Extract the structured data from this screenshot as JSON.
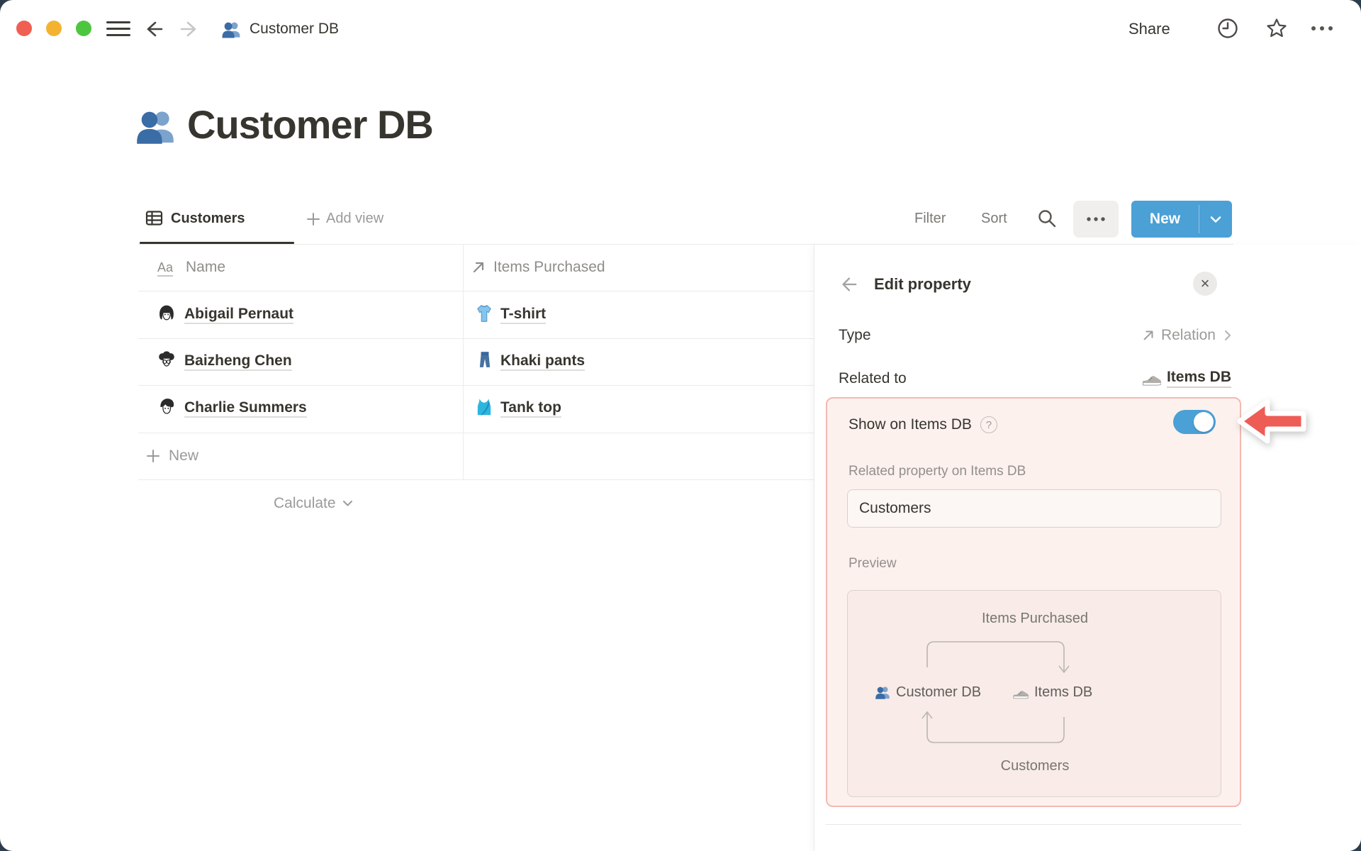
{
  "topbar": {
    "document_title": "Customer DB",
    "share_label": "Share"
  },
  "page": {
    "icon": "people-icon",
    "title": "Customer DB"
  },
  "view_bar": {
    "active_view": "Customers",
    "add_view_label": "Add view",
    "filter_label": "Filter",
    "sort_label": "Sort",
    "new_button_label": "New"
  },
  "table": {
    "columns": [
      {
        "icon": "title-aa-icon",
        "label": "Name"
      },
      {
        "icon": "relation-arrow-icon",
        "label": "Items Purchased"
      }
    ],
    "rows": [
      {
        "avatar": "avatar-abigail",
        "name": "Abigail Pernaut",
        "item_icon": "t-shirt-icon",
        "item": "T-shirt"
      },
      {
        "avatar": "avatar-baizheng",
        "name": "Baizheng Chen",
        "item_icon": "jeans-icon",
        "item": "Khaki pants"
      },
      {
        "avatar": "avatar-charlie",
        "name": "Charlie Summers",
        "item_icon": "tank-top-icon",
        "item": "Tank top"
      }
    ],
    "new_row_label": "New",
    "calculate_label": "Calculate"
  },
  "panel": {
    "title": "Edit property",
    "type_label": "Type",
    "type_value": "Relation",
    "related_to_label": "Related to",
    "related_to_icon": "sneaker-icon",
    "related_to_value": "Items DB",
    "show_toggle_label": "Show on Items DB",
    "toggle_state": "on",
    "related_property_label": "Related property on Items DB",
    "related_property_value": "Customers",
    "preview_label": "Preview",
    "preview": {
      "top_relation_label": "Items Purchased",
      "left_node": "Customer DB",
      "right_node": "Items DB",
      "bottom_relation_label": "Customers"
    }
  },
  "colors": {
    "accent_blue": "#4ba0d6",
    "highlight_background": "#fdf1ee",
    "highlight_border": "#f4b8b3",
    "annotation_arrow_red": "#ee5c56",
    "text_primary": "#37352f",
    "text_gray": "#9b9a97"
  }
}
